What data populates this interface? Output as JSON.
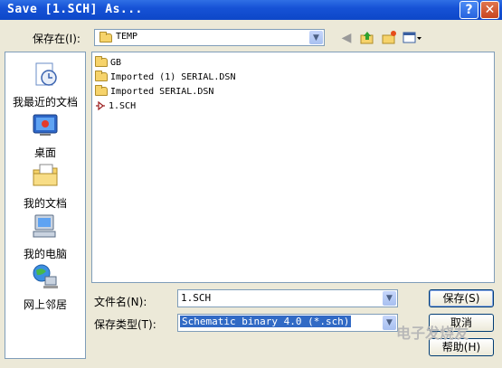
{
  "window": {
    "title": "Save [1.SCH] As...",
    "help_button": "?",
    "close_button": "✕"
  },
  "toolbar": {
    "save_in_label": "保存在(I):",
    "save_in_value": "TEMP",
    "icons": [
      "back-icon",
      "up-folder-icon",
      "new-folder-icon",
      "view-menu-icon"
    ]
  },
  "places": [
    {
      "label": "我最近的文档",
      "icon": "recent-documents-icon"
    },
    {
      "label": "桌面",
      "icon": "desktop-icon"
    },
    {
      "label": "我的文档",
      "icon": "my-documents-icon"
    },
    {
      "label": "我的电脑",
      "icon": "my-computer-icon"
    },
    {
      "label": "网上邻居",
      "icon": "network-places-icon"
    }
  ],
  "files": [
    {
      "name": "GB",
      "type": "folder"
    },
    {
      "name": "Imported (1) SERIAL.DSN",
      "type": "folder"
    },
    {
      "name": "Imported SERIAL.DSN",
      "type": "folder"
    },
    {
      "name": "1.SCH",
      "type": "schematic"
    }
  ],
  "form": {
    "filename_label": "文件名(N):",
    "filename_value": "1.SCH",
    "filetype_label": "保存类型(T):",
    "filetype_value": "Schematic binary 4.0 (*.sch)"
  },
  "buttons": {
    "save": "保存(S)",
    "cancel": "取消",
    "help": "帮助(H)"
  },
  "watermark": "电子发烧友"
}
